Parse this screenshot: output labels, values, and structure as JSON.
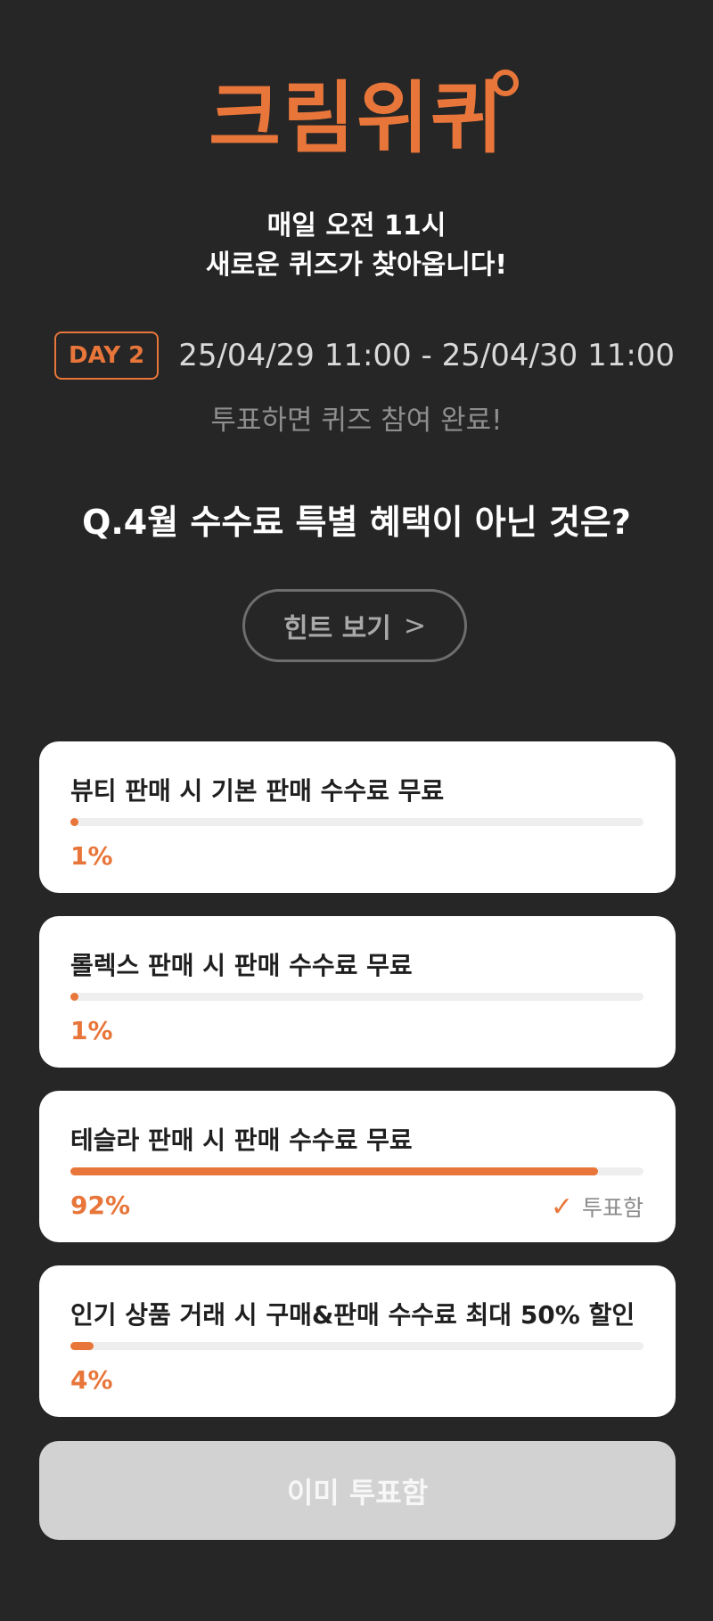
{
  "header": {
    "logo_text": "크림위퀴",
    "subtitle_line1": "매일 오전 11시",
    "subtitle_line2": "새로운 퀴즈가 찾아옵니다!"
  },
  "schedule": {
    "day_badge": "DAY 2",
    "range": "25/04/29 11:00 - 25/04/30 11:00",
    "note": "투표하면 퀴즈 참여 완료!"
  },
  "quiz": {
    "question": "Q.4월 수수료 특별 혜택이 아닌 것은?",
    "hint_label": "힌트 보기",
    "hint_icon": "chevron-right-icon",
    "options": [
      {
        "label": "뷰티 판매 시 기본 판매 수수료 무료",
        "percent_label": "1%",
        "percent": 1,
        "voted": false
      },
      {
        "label": "롤렉스 판매 시 판매 수수료 무료",
        "percent_label": "1%",
        "percent": 1,
        "voted": false
      },
      {
        "label": "테슬라 판매 시 판매 수수료 무료",
        "percent_label": "92%",
        "percent": 92,
        "voted": true,
        "voted_label": "투표함",
        "voted_icon": "check-icon"
      },
      {
        "label": "인기 상품 거래 시 구매&판매 수수료 최대 50% 할인",
        "percent_label": "4%",
        "percent": 4,
        "voted": false
      }
    ],
    "submit_label": "이미 투표함"
  },
  "colors": {
    "accent": "#E8763A",
    "background": "#262626",
    "card": "#ffffff",
    "disabled_button": "#d2d2d2"
  }
}
